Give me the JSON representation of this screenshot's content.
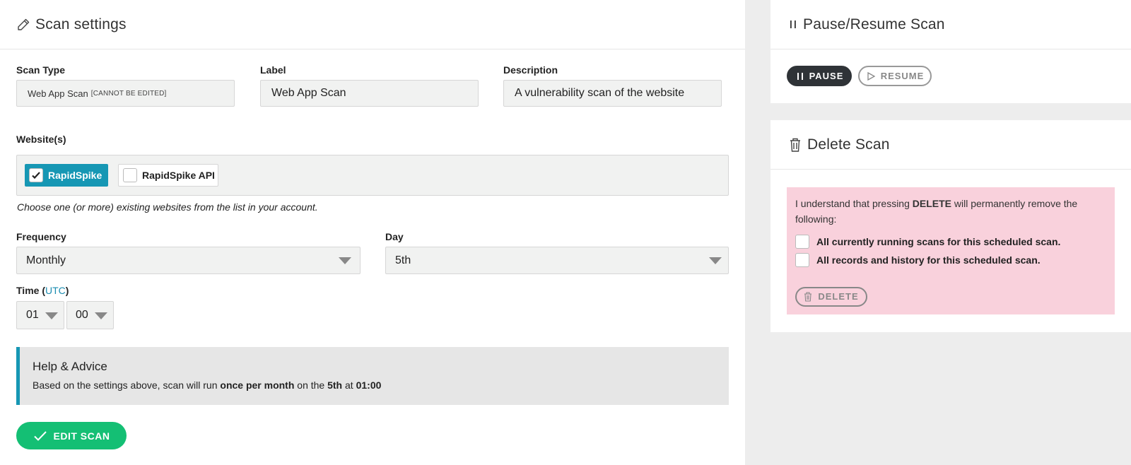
{
  "settings": {
    "title": "Scan settings",
    "scan_type_label": "Scan Type",
    "scan_type_value": "Web App Scan",
    "scan_type_note": "[CANNOT BE EDITED]",
    "label_label": "Label",
    "label_value": "Web App Scan",
    "description_label": "Description",
    "description_value": "A vulnerability scan of the website",
    "websites_label": "Website(s)",
    "websites": [
      {
        "name": "RapidSpike",
        "checked": true
      },
      {
        "name": "RapidSpike API",
        "checked": false
      }
    ],
    "websites_hint": "Choose one (or more) existing websites from the list in your account.",
    "frequency_label": "Frequency",
    "frequency_value": "Monthly",
    "day_label": "Day",
    "day_value": "5th",
    "time_label_prefix": "Time (",
    "time_label_link": "UTC",
    "time_label_suffix": ")",
    "time_hour": "01",
    "time_minute": "00",
    "edit_button": "EDIT SCAN"
  },
  "help": {
    "title": "Help & Advice",
    "text_1": "Based on the settings above, scan will run ",
    "freq": "once per month",
    "text_2": " on the ",
    "day": "5th",
    "text_3": " at ",
    "time": "01:00"
  },
  "pause_resume": {
    "title": "Pause/Resume Scan",
    "pause_label": "PAUSE",
    "resume_label": "RESUME"
  },
  "delete_scan": {
    "title": "Delete Scan",
    "warning_1": "I understand that pressing ",
    "warning_keyword": "DELETE",
    "warning_2": " will permanently remove the following:",
    "items": [
      "All currently running scans for this scheduled scan.",
      "All records and history for this scheduled scan."
    ],
    "delete_button": "DELETE"
  },
  "colors": {
    "accent": "#1697b4",
    "success": "#14bf74",
    "danger_bg": "#f9d1dc",
    "dark_button": "#2f3337"
  },
  "icons": [
    "pencil-icon",
    "pause-icon",
    "play-icon",
    "trash-icon",
    "check-icon",
    "chevron-down-icon"
  ]
}
